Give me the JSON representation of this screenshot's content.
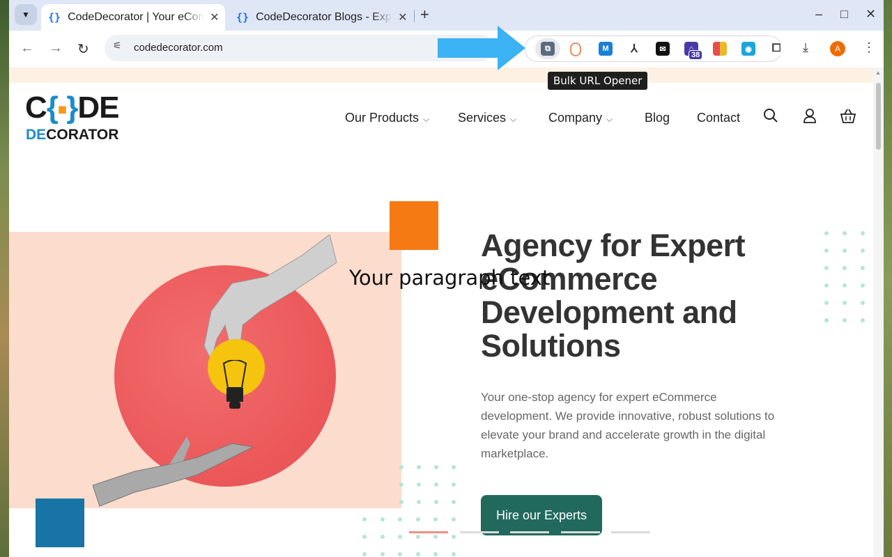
{
  "browser": {
    "tabs": [
      {
        "title": "CodeDecorator | Your eCommerce Development Agency",
        "active": true
      },
      {
        "title": "CodeDecorator Blogs - Expert Insights",
        "active": false
      }
    ],
    "new_tab_label": "+",
    "window_controls": {
      "minimize": "–",
      "maximize": "□",
      "close": "✕"
    },
    "url": "codedecorator.com",
    "extensions": [
      {
        "name": "Bulk URL Opener",
        "color": "#5a6b7d"
      },
      {
        "name": "extension-2",
        "color": "#f08a5d"
      },
      {
        "name": "extension-3",
        "color": "#1a7fd6"
      },
      {
        "name": "extension-4",
        "color": "#333333"
      },
      {
        "name": "extension-5",
        "color": "#111111"
      },
      {
        "name": "extension-6",
        "color": "#4a3aa8",
        "badge": "38"
      },
      {
        "name": "extension-7",
        "color": "#e8b92a"
      },
      {
        "name": "extension-8",
        "color": "#1aa6d9"
      },
      {
        "name": "extensions-menu",
        "color": "#444444"
      }
    ],
    "avatar_letter": "A",
    "tooltip": "Bulk URL Opener"
  },
  "site": {
    "logo": {
      "top": "C{·}DE",
      "bottom_de": "DE",
      "bottom_rest": "CORATOR"
    },
    "nav": [
      {
        "label": "Our Products",
        "dropdown": true
      },
      {
        "label": "Services",
        "dropdown": true
      },
      {
        "label": "Company",
        "dropdown": true
      },
      {
        "label": "Blog",
        "dropdown": false
      },
      {
        "label": "Contact",
        "dropdown": false
      }
    ],
    "hero": {
      "title": "Agency for Expert eCommerce Development and Solutions",
      "overlay_text": "Your paragraph text",
      "description": "Your one-stop agency for expert eCommerce development. We provide innovative, robust solutions to elevate your brand and accelerate growth in the digital marketplace.",
      "cta": "Hire our Experts"
    },
    "colors": {
      "accent_orange": "#f57a14",
      "accent_blue": "#1774a4",
      "cta_green": "#21695d",
      "hero_pink": "#fbdccd"
    }
  }
}
